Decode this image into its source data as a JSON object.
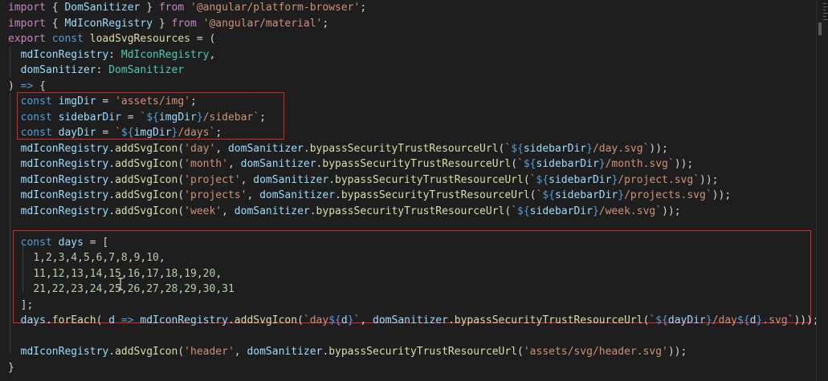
{
  "editor": {
    "lines": [
      [
        {
          "t": "import",
          "c": "kc"
        },
        {
          "t": " { ",
          "c": "p"
        },
        {
          "t": "DomSanitizer",
          "c": "id"
        },
        {
          "t": " } ",
          "c": "p"
        },
        {
          "t": "from",
          "c": "kc"
        },
        {
          "t": " ",
          "c": "p"
        },
        {
          "t": "'@angular/platform-browser'",
          "c": "s"
        },
        {
          "t": ";",
          "c": "p"
        }
      ],
      [
        {
          "t": "import",
          "c": "kc"
        },
        {
          "t": " { ",
          "c": "p"
        },
        {
          "t": "MdIconRegistry",
          "c": "id"
        },
        {
          "t": " } ",
          "c": "p"
        },
        {
          "t": "from",
          "c": "kc"
        },
        {
          "t": " ",
          "c": "p"
        },
        {
          "t": "'@angular/material'",
          "c": "s"
        },
        {
          "t": ";",
          "c": "p"
        }
      ],
      [
        {
          "t": "export",
          "c": "kc"
        },
        {
          "t": " ",
          "c": "p"
        },
        {
          "t": "const",
          "c": "k"
        },
        {
          "t": " ",
          "c": "p"
        },
        {
          "t": "loadSvgResources",
          "c": "fn"
        },
        {
          "t": " = (",
          "c": "p"
        }
      ],
      [
        {
          "t": "  ",
          "c": "p"
        },
        {
          "t": "mdIconRegistry",
          "c": "id"
        },
        {
          "t": ": ",
          "c": "p"
        },
        {
          "t": "MdIconRegistry",
          "c": "cl"
        },
        {
          "t": ",",
          "c": "p"
        }
      ],
      [
        {
          "t": "  ",
          "c": "p"
        },
        {
          "t": "domSanitizer",
          "c": "id"
        },
        {
          "t": ": ",
          "c": "p"
        },
        {
          "t": "DomSanitizer",
          "c": "cl"
        }
      ],
      [
        {
          "t": ") ",
          "c": "p"
        },
        {
          "t": "=>",
          "c": "k"
        },
        {
          "t": " {",
          "c": "p"
        }
      ],
      [
        {
          "t": "  ",
          "c": "p"
        },
        {
          "t": "const",
          "c": "k"
        },
        {
          "t": " ",
          "c": "p"
        },
        {
          "t": "imgDir",
          "c": "id"
        },
        {
          "t": " = ",
          "c": "p"
        },
        {
          "t": "'assets/img'",
          "c": "s"
        },
        {
          "t": ";",
          "c": "p"
        }
      ],
      [
        {
          "t": "  ",
          "c": "p"
        },
        {
          "t": "const",
          "c": "k"
        },
        {
          "t": " ",
          "c": "p"
        },
        {
          "t": "sidebarDir",
          "c": "id"
        },
        {
          "t": " = ",
          "c": "p"
        },
        {
          "t": "`",
          "c": "s"
        },
        {
          "t": "${",
          "c": "sub"
        },
        {
          "t": "imgDir",
          "c": "id"
        },
        {
          "t": "}",
          "c": "sub"
        },
        {
          "t": "/sidebar`",
          "c": "s"
        },
        {
          "t": ";",
          "c": "p"
        }
      ],
      [
        {
          "t": "  ",
          "c": "p"
        },
        {
          "t": "const",
          "c": "k"
        },
        {
          "t": " ",
          "c": "p"
        },
        {
          "t": "dayDir",
          "c": "id"
        },
        {
          "t": " = ",
          "c": "p"
        },
        {
          "t": "`",
          "c": "s"
        },
        {
          "t": "${",
          "c": "sub"
        },
        {
          "t": "imgDir",
          "c": "id"
        },
        {
          "t": "}",
          "c": "sub"
        },
        {
          "t": "/days`",
          "c": "s"
        },
        {
          "t": ";",
          "c": "p"
        }
      ],
      [
        {
          "t": "  ",
          "c": "p"
        },
        {
          "t": "mdIconRegistry",
          "c": "id"
        },
        {
          "t": ".",
          "c": "p"
        },
        {
          "t": "addSvgIcon",
          "c": "fn"
        },
        {
          "t": "(",
          "c": "p"
        },
        {
          "t": "'day'",
          "c": "s"
        },
        {
          "t": ", ",
          "c": "p"
        },
        {
          "t": "domSanitizer",
          "c": "id"
        },
        {
          "t": ".",
          "c": "p"
        },
        {
          "t": "bypassSecurityTrustResourceUrl",
          "c": "fn"
        },
        {
          "t": "(",
          "c": "p"
        },
        {
          "t": "`",
          "c": "s"
        },
        {
          "t": "${",
          "c": "sub"
        },
        {
          "t": "sidebarDir",
          "c": "id"
        },
        {
          "t": "}",
          "c": "sub"
        },
        {
          "t": "/day.svg`",
          "c": "s"
        },
        {
          "t": "));",
          "c": "p"
        }
      ],
      [
        {
          "t": "  ",
          "c": "p"
        },
        {
          "t": "mdIconRegistry",
          "c": "id"
        },
        {
          "t": ".",
          "c": "p"
        },
        {
          "t": "addSvgIcon",
          "c": "fn"
        },
        {
          "t": "(",
          "c": "p"
        },
        {
          "t": "'month'",
          "c": "s"
        },
        {
          "t": ", ",
          "c": "p"
        },
        {
          "t": "domSanitizer",
          "c": "id"
        },
        {
          "t": ".",
          "c": "p"
        },
        {
          "t": "bypassSecurityTrustResourceUrl",
          "c": "fn"
        },
        {
          "t": "(",
          "c": "p"
        },
        {
          "t": "`",
          "c": "s"
        },
        {
          "t": "${",
          "c": "sub"
        },
        {
          "t": "sidebarDir",
          "c": "id"
        },
        {
          "t": "}",
          "c": "sub"
        },
        {
          "t": "/month.svg`",
          "c": "s"
        },
        {
          "t": "));",
          "c": "p"
        }
      ],
      [
        {
          "t": "  ",
          "c": "p"
        },
        {
          "t": "mdIconRegistry",
          "c": "id"
        },
        {
          "t": ".",
          "c": "p"
        },
        {
          "t": "addSvgIcon",
          "c": "fn"
        },
        {
          "t": "(",
          "c": "p"
        },
        {
          "t": "'project'",
          "c": "s"
        },
        {
          "t": ", ",
          "c": "p"
        },
        {
          "t": "domSanitizer",
          "c": "id"
        },
        {
          "t": ".",
          "c": "p"
        },
        {
          "t": "bypassSecurityTrustResourceUrl",
          "c": "fn"
        },
        {
          "t": "(",
          "c": "p"
        },
        {
          "t": "`",
          "c": "s"
        },
        {
          "t": "${",
          "c": "sub"
        },
        {
          "t": "sidebarDir",
          "c": "id"
        },
        {
          "t": "}",
          "c": "sub"
        },
        {
          "t": "/project.svg`",
          "c": "s"
        },
        {
          "t": "));",
          "c": "p"
        }
      ],
      [
        {
          "t": "  ",
          "c": "p"
        },
        {
          "t": "mdIconRegistry",
          "c": "id"
        },
        {
          "t": ".",
          "c": "p"
        },
        {
          "t": "addSvgIcon",
          "c": "fn"
        },
        {
          "t": "(",
          "c": "p"
        },
        {
          "t": "'projects'",
          "c": "s"
        },
        {
          "t": ", ",
          "c": "p"
        },
        {
          "t": "domSanitizer",
          "c": "id"
        },
        {
          "t": ".",
          "c": "p"
        },
        {
          "t": "bypassSecurityTrustResourceUrl",
          "c": "fn"
        },
        {
          "t": "(",
          "c": "p"
        },
        {
          "t": "`",
          "c": "s"
        },
        {
          "t": "${",
          "c": "sub"
        },
        {
          "t": "sidebarDir",
          "c": "id"
        },
        {
          "t": "}",
          "c": "sub"
        },
        {
          "t": "/projects.svg`",
          "c": "s"
        },
        {
          "t": "));",
          "c": "p"
        }
      ],
      [
        {
          "t": "  ",
          "c": "p"
        },
        {
          "t": "mdIconRegistry",
          "c": "id"
        },
        {
          "t": ".",
          "c": "p"
        },
        {
          "t": "addSvgIcon",
          "c": "fn"
        },
        {
          "t": "(",
          "c": "p"
        },
        {
          "t": "'week'",
          "c": "s"
        },
        {
          "t": ", ",
          "c": "p"
        },
        {
          "t": "domSanitizer",
          "c": "id"
        },
        {
          "t": ".",
          "c": "p"
        },
        {
          "t": "bypassSecurityTrustResourceUrl",
          "c": "fn"
        },
        {
          "t": "(",
          "c": "p"
        },
        {
          "t": "`",
          "c": "s"
        },
        {
          "t": "${",
          "c": "sub"
        },
        {
          "t": "sidebarDir",
          "c": "id"
        },
        {
          "t": "}",
          "c": "sub"
        },
        {
          "t": "/week.svg`",
          "c": "s"
        },
        {
          "t": "));",
          "c": "p"
        }
      ],
      [],
      [
        {
          "t": "  ",
          "c": "p"
        },
        {
          "t": "const",
          "c": "k"
        },
        {
          "t": " ",
          "c": "p"
        },
        {
          "t": "days",
          "c": "id"
        },
        {
          "t": " = [",
          "c": "p"
        }
      ],
      [
        {
          "t": "    ",
          "c": "p"
        },
        {
          "t": "1",
          "c": "n"
        },
        {
          "t": ",",
          "c": "p"
        },
        {
          "t": "2",
          "c": "n"
        },
        {
          "t": ",",
          "c": "p"
        },
        {
          "t": "3",
          "c": "n"
        },
        {
          "t": ",",
          "c": "p"
        },
        {
          "t": "4",
          "c": "n"
        },
        {
          "t": ",",
          "c": "p"
        },
        {
          "t": "5",
          "c": "n"
        },
        {
          "t": ",",
          "c": "p"
        },
        {
          "t": "6",
          "c": "n"
        },
        {
          "t": ",",
          "c": "p"
        },
        {
          "t": "7",
          "c": "n"
        },
        {
          "t": ",",
          "c": "p"
        },
        {
          "t": "8",
          "c": "n"
        },
        {
          "t": ",",
          "c": "p"
        },
        {
          "t": "9",
          "c": "n"
        },
        {
          "t": ",",
          "c": "p"
        },
        {
          "t": "10",
          "c": "n"
        },
        {
          "t": ",",
          "c": "p"
        }
      ],
      [
        {
          "t": "    ",
          "c": "p"
        },
        {
          "t": "11",
          "c": "n"
        },
        {
          "t": ",",
          "c": "p"
        },
        {
          "t": "12",
          "c": "n"
        },
        {
          "t": ",",
          "c": "p"
        },
        {
          "t": "13",
          "c": "n"
        },
        {
          "t": ",",
          "c": "p"
        },
        {
          "t": "14",
          "c": "n"
        },
        {
          "t": ",",
          "c": "p"
        },
        {
          "t": "15",
          "c": "n"
        },
        {
          "t": ",",
          "c": "p"
        },
        {
          "t": "16",
          "c": "n"
        },
        {
          "t": ",",
          "c": "p"
        },
        {
          "t": "17",
          "c": "n"
        },
        {
          "t": ",",
          "c": "p"
        },
        {
          "t": "18",
          "c": "n"
        },
        {
          "t": ",",
          "c": "p"
        },
        {
          "t": "19",
          "c": "n"
        },
        {
          "t": ",",
          "c": "p"
        },
        {
          "t": "20",
          "c": "n"
        },
        {
          "t": ",",
          "c": "p"
        }
      ],
      [
        {
          "t": "    ",
          "c": "p"
        },
        {
          "t": "21",
          "c": "n"
        },
        {
          "t": ",",
          "c": "p"
        },
        {
          "t": "22",
          "c": "n"
        },
        {
          "t": ",",
          "c": "p"
        },
        {
          "t": "23",
          "c": "n"
        },
        {
          "t": ",",
          "c": "p"
        },
        {
          "t": "24",
          "c": "n"
        },
        {
          "t": ",",
          "c": "p"
        },
        {
          "t": "25",
          "c": "n"
        },
        {
          "t": ",",
          "c": "p"
        },
        {
          "t": "26",
          "c": "n"
        },
        {
          "t": ",",
          "c": "p"
        },
        {
          "t": "27",
          "c": "n"
        },
        {
          "t": ",",
          "c": "p"
        },
        {
          "t": "28",
          "c": "n"
        },
        {
          "t": ",",
          "c": "p"
        },
        {
          "t": "29",
          "c": "n"
        },
        {
          "t": ",",
          "c": "p"
        },
        {
          "t": "30",
          "c": "n"
        },
        {
          "t": ",",
          "c": "p"
        },
        {
          "t": "31",
          "c": "n"
        }
      ],
      [
        {
          "t": "  ];",
          "c": "p"
        }
      ],
      [
        {
          "t": "  ",
          "c": "p"
        },
        {
          "t": "days",
          "c": "id"
        },
        {
          "t": ".",
          "c": "p"
        },
        {
          "t": "forEach",
          "c": "fn"
        },
        {
          "t": "( ",
          "c": "p"
        },
        {
          "t": "d",
          "c": "id"
        },
        {
          "t": " ",
          "c": "p"
        },
        {
          "t": "=>",
          "c": "k"
        },
        {
          "t": " ",
          "c": "p"
        },
        {
          "t": "mdIconRegistry",
          "c": "id"
        },
        {
          "t": ".",
          "c": "p"
        },
        {
          "t": "addSvgIcon",
          "c": "fn"
        },
        {
          "t": "(",
          "c": "p"
        },
        {
          "t": "`day",
          "c": "s"
        },
        {
          "t": "${",
          "c": "sub"
        },
        {
          "t": "d",
          "c": "id"
        },
        {
          "t": "}",
          "c": "sub"
        },
        {
          "t": "`",
          "c": "s"
        },
        {
          "t": ", ",
          "c": "p"
        },
        {
          "t": "domSanitizer",
          "c": "id"
        },
        {
          "t": ".",
          "c": "p"
        },
        {
          "t": "bypassSecurityTrustResourceUrl",
          "c": "fn"
        },
        {
          "t": "(",
          "c": "p"
        },
        {
          "t": "`",
          "c": "s"
        },
        {
          "t": "${",
          "c": "sub"
        },
        {
          "t": "dayDir",
          "c": "id"
        },
        {
          "t": "}",
          "c": "sub"
        },
        {
          "t": "/day",
          "c": "s"
        },
        {
          "t": "${",
          "c": "sub"
        },
        {
          "t": "d",
          "c": "id"
        },
        {
          "t": "}",
          "c": "sub"
        },
        {
          "t": ".svg`",
          "c": "s"
        },
        {
          "t": ")));",
          "c": "p"
        }
      ],
      [],
      [
        {
          "t": "  ",
          "c": "p"
        },
        {
          "t": "mdIconRegistry",
          "c": "id"
        },
        {
          "t": ".",
          "c": "p"
        },
        {
          "t": "addSvgIcon",
          "c": "fn"
        },
        {
          "t": "(",
          "c": "p"
        },
        {
          "t": "'header'",
          "c": "s"
        },
        {
          "t": ", ",
          "c": "p"
        },
        {
          "t": "domSanitizer",
          "c": "id"
        },
        {
          "t": ".",
          "c": "p"
        },
        {
          "t": "bypassSecurityTrustResourceUrl",
          "c": "fn"
        },
        {
          "t": "(",
          "c": "p"
        },
        {
          "t": "'assets/svg/header.svg'",
          "c": "s"
        },
        {
          "t": "));",
          "c": "p"
        }
      ],
      [
        {
          "t": "}",
          "c": "p"
        }
      ]
    ]
  },
  "colors": {
    "background": "#1e1e1e",
    "highlight_box": "#e0262a",
    "keyword": "#569cd6",
    "import_keyword": "#c586c0",
    "identifier": "#9cdcfe",
    "function": "#dcdcaa",
    "type": "#4ec9b0",
    "string": "#ce9178",
    "number": "#b5cea8"
  },
  "cursor": {
    "type": "text-cursor",
    "icon": "i-beam-cursor-icon"
  }
}
